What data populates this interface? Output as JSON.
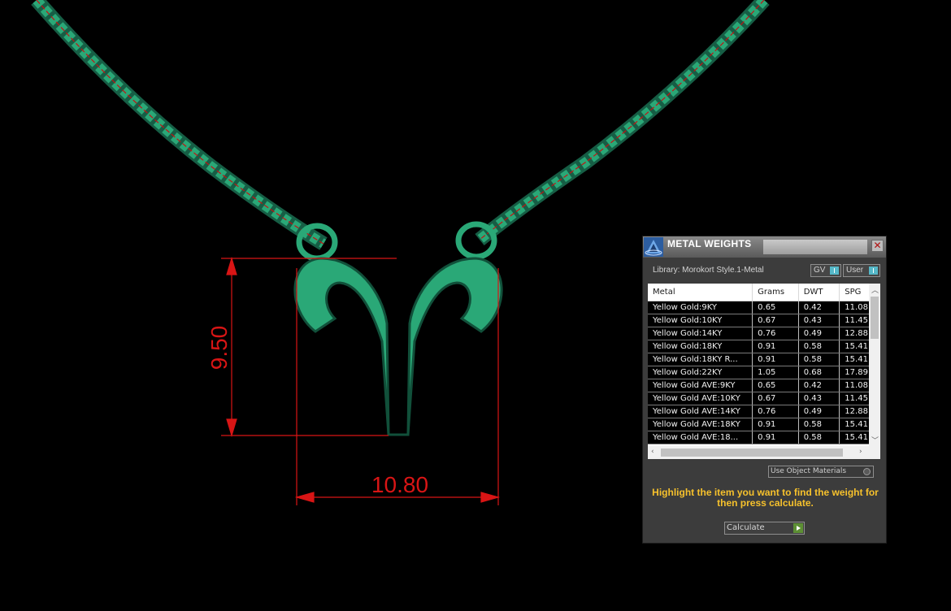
{
  "viewport": {
    "dimension_height": "9.50",
    "dimension_width": "10.80",
    "colors": {
      "background": "#000000",
      "model": "#2aa877",
      "dimension": "#d81515"
    }
  },
  "panel": {
    "title": "METAL WEIGHTS",
    "library_label": "Library: Morokort Style.1-Metal",
    "toggle_gv": "GV",
    "toggle_user": "User",
    "columns": [
      "Metal",
      "Grams",
      "DWT",
      "SPG"
    ],
    "rows": [
      [
        "Yellow Gold:9KY",
        "0.65",
        "0.42",
        "11.08"
      ],
      [
        "Yellow Gold:10KY",
        "0.67",
        "0.43",
        "11.45"
      ],
      [
        "Yellow Gold:14KY",
        "0.76",
        "0.49",
        "12.88"
      ],
      [
        "Yellow Gold:18KY",
        "0.91",
        "0.58",
        "15.41"
      ],
      [
        "Yellow Gold:18KY R...",
        "0.91",
        "0.58",
        "15.41"
      ],
      [
        "Yellow Gold:22KY",
        "1.05",
        "0.68",
        "17.89"
      ],
      [
        "Yellow Gold AVE:9KY",
        "0.65",
        "0.42",
        "11.08"
      ],
      [
        "Yellow Gold AVE:10KY",
        "0.67",
        "0.43",
        "11.45"
      ],
      [
        "Yellow Gold AVE:14KY",
        "0.76",
        "0.49",
        "12.88"
      ],
      [
        "Yellow Gold AVE:18KY",
        "0.91",
        "0.58",
        "15.41"
      ],
      [
        "Yellow Gold AVE:18...",
        "0.91",
        "0.58",
        "15.41"
      ]
    ],
    "use_object_materials": "Use Object Materials",
    "hint": "Highlight the item you want to find the weight for then press calculate.",
    "calculate_label": "Calculate",
    "colors": {
      "hint": "#f6c12c",
      "toggle_knob": "#55b8c8",
      "calculate_play": "#5d8f34"
    }
  }
}
